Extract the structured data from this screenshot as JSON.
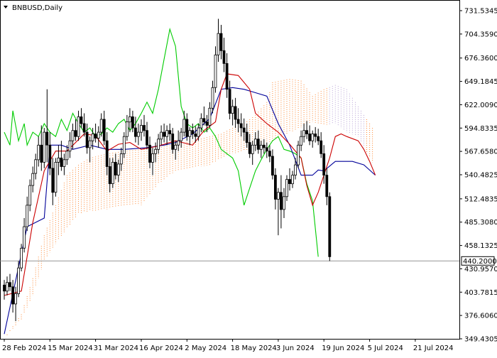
{
  "chart_data": {
    "type": "candlestick",
    "title": "BNBUSD,Daily",
    "current_price": 440.2,
    "current_price_label": "440.2000",
    "ylim": [
      349.43,
      731.5345
    ],
    "y_ticks": [
      {
        "label": "731.5345",
        "value": 731.5345
      },
      {
        "label": "704.3590",
        "value": 704.359
      },
      {
        "label": "676.3600",
        "value": 676.36
      },
      {
        "label": "649.1845",
        "value": 649.1845
      },
      {
        "label": "622.0090",
        "value": 622.009
      },
      {
        "label": "594.8335",
        "value": 594.8335
      },
      {
        "label": "567.6580",
        "value": 567.658
      },
      {
        "label": "540.4825",
        "value": 540.4825
      },
      {
        "label": "512.4835",
        "value": 512.4835
      },
      {
        "label": "485.3080",
        "value": 485.308
      },
      {
        "label": "458.1325",
        "value": 458.1325
      },
      {
        "label": "430.9570",
        "value": 430.957
      },
      {
        "label": "403.7815",
        "value": 403.7815
      },
      {
        "label": "376.6060",
        "value": 376.606
      },
      {
        "label": "349.4305",
        "value": 349.4305
      }
    ],
    "x_ticks": [
      {
        "label": "28 Feb 2024",
        "index": 0
      },
      {
        "label": "15 Mar 2024",
        "index": 16
      },
      {
        "label": "31 Mar 2024",
        "index": 32
      },
      {
        "label": "16 Apr 2024",
        "index": 48
      },
      {
        "label": "2 May 2024",
        "index": 64
      },
      {
        "label": "18 May 2024",
        "index": 80
      },
      {
        "label": "3 Jun 2024",
        "index": 96
      },
      {
        "label": "19 Jun 2024",
        "index": 112
      },
      {
        "label": "5 Jul 2024",
        "index": 128
      },
      {
        "label": "21 Jul 2024",
        "index": 144
      }
    ],
    "colors": {
      "tenkan": "#cc0000",
      "kijun": "#000099",
      "chikou": "#00cc00",
      "cloud": "#ff8833",
      "cloud_alt": "#b9a3d6",
      "candle": "#000000",
      "price_line": "#888888"
    },
    "candles": [
      [
        412,
        418,
        395,
        405
      ],
      [
        405,
        422,
        400,
        415
      ],
      [
        415,
        425,
        405,
        410
      ],
      [
        410,
        418,
        380,
        390
      ],
      [
        390,
        410,
        370,
        402
      ],
      [
        402,
        440,
        398,
        432
      ],
      [
        432,
        460,
        428,
        455
      ],
      [
        455,
        490,
        450,
        480
      ],
      [
        480,
        515,
        475,
        505
      ],
      [
        505,
        535,
        498,
        528
      ],
      [
        528,
        550,
        520,
        542
      ],
      [
        542,
        565,
        535,
        558
      ],
      [
        558,
        585,
        550,
        575
      ],
      [
        575,
        598,
        545,
        555
      ],
      [
        555,
        595,
        548,
        590
      ],
      [
        590,
        640,
        555,
        575
      ],
      [
        575,
        590,
        540,
        548
      ],
      [
        548,
        560,
        505,
        520
      ],
      [
        520,
        560,
        515,
        555
      ],
      [
        555,
        575,
        540,
        560
      ],
      [
        560,
        580,
        545,
        550
      ],
      [
        550,
        565,
        540,
        558
      ],
      [
        558,
        575,
        552,
        568
      ],
      [
        568,
        590,
        560,
        580
      ],
      [
        580,
        600,
        570,
        592
      ],
      [
        592,
        605,
        580,
        585
      ],
      [
        585,
        615,
        580,
        608
      ],
      [
        608,
        618,
        595,
        600
      ],
      [
        600,
        612,
        585,
        590
      ],
      [
        590,
        600,
        565,
        572
      ],
      [
        572,
        585,
        555,
        580
      ],
      [
        580,
        595,
        570,
        588
      ],
      [
        588,
        600,
        578,
        583
      ],
      [
        583,
        597,
        572,
        590
      ],
      [
        590,
        612,
        585,
        605
      ],
      [
        605,
        615,
        575,
        580
      ],
      [
        580,
        590,
        540,
        550
      ],
      [
        550,
        560,
        520,
        530
      ],
      [
        530,
        560,
        525,
        555
      ],
      [
        555,
        565,
        535,
        540
      ],
      [
        540,
        558,
        532,
        553
      ],
      [
        553,
        572,
        545,
        565
      ],
      [
        565,
        590,
        560,
        585
      ],
      [
        585,
        610,
        580,
        602
      ],
      [
        602,
        618,
        590,
        608
      ],
      [
        608,
        615,
        590,
        595
      ],
      [
        595,
        608,
        578,
        585
      ],
      [
        585,
        600,
        575,
        590
      ],
      [
        590,
        605,
        580,
        598
      ],
      [
        598,
        610,
        585,
        592
      ],
      [
        592,
        602,
        570,
        575
      ],
      [
        575,
        585,
        548,
        555
      ],
      [
        555,
        572,
        540,
        565
      ],
      [
        565,
        578,
        555,
        570
      ],
      [
        570,
        588,
        565,
        582
      ],
      [
        582,
        598,
        575,
        590
      ],
      [
        590,
        600,
        578,
        585
      ],
      [
        585,
        598,
        575,
        592
      ],
      [
        592,
        600,
        580,
        588
      ],
      [
        588,
        595,
        565,
        570
      ],
      [
        570,
        580,
        558,
        575
      ],
      [
        575,
        592,
        568,
        580
      ],
      [
        580,
        595,
        572,
        590
      ],
      [
        590,
        615,
        585,
        605
      ],
      [
        605,
        612,
        580,
        585
      ],
      [
        585,
        596,
        575,
        592
      ],
      [
        592,
        600,
        582,
        588
      ],
      [
        588,
        597,
        578,
        585
      ],
      [
        585,
        600,
        580,
        595
      ],
      [
        595,
        612,
        590,
        606
      ],
      [
        606,
        620,
        598,
        602
      ],
      [
        602,
        610,
        590,
        598
      ],
      [
        598,
        625,
        595,
        618
      ],
      [
        618,
        650,
        612,
        642
      ],
      [
        642,
        690,
        636,
        680
      ],
      [
        680,
        722,
        672,
        705
      ],
      [
        705,
        715,
        675,
        685
      ],
      [
        685,
        700,
        660,
        670
      ],
      [
        670,
        682,
        630,
        640
      ],
      [
        640,
        650,
        605,
        612
      ],
      [
        612,
        628,
        598,
        620
      ],
      [
        620,
        630,
        595,
        605
      ],
      [
        605,
        618,
        590,
        600
      ],
      [
        600,
        612,
        585,
        595
      ],
      [
        595,
        606,
        580,
        590
      ],
      [
        590,
        600,
        572,
        578
      ],
      [
        578,
        588,
        560,
        565
      ],
      [
        565,
        580,
        552,
        575
      ],
      [
        575,
        590,
        568,
        582
      ],
      [
        582,
        592,
        565,
        570
      ],
      [
        570,
        580,
        560,
        575
      ],
      [
        575,
        582,
        565,
        572
      ],
      [
        572,
        578,
        560,
        568
      ],
      [
        568,
        575,
        555,
        562
      ],
      [
        562,
        570,
        535,
        540
      ],
      [
        540,
        548,
        500,
        512
      ],
      [
        512,
        525,
        470,
        520
      ],
      [
        520,
        540,
        478,
        500
      ],
      [
        500,
        525,
        490,
        515
      ],
      [
        515,
        540,
        510,
        535
      ],
      [
        535,
        548,
        522,
        530
      ],
      [
        530,
        545,
        525,
        540
      ],
      [
        540,
        560,
        535,
        552
      ],
      [
        552,
        580,
        548,
        575
      ],
      [
        575,
        592,
        568,
        585
      ],
      [
        585,
        600,
        578,
        592
      ],
      [
        592,
        603,
        582,
        588
      ],
      [
        588,
        598,
        575,
        580
      ],
      [
        580,
        592,
        572,
        588
      ],
      [
        588,
        596,
        578,
        585
      ],
      [
        585,
        594,
        575,
        580
      ],
      [
        580,
        590,
        560,
        565
      ],
      [
        565,
        575,
        530,
        540
      ],
      [
        540,
        548,
        505,
        515
      ],
      [
        515,
        520,
        440,
        445
      ]
    ],
    "tenkan": [
      [
        0,
        400
      ],
      [
        6,
        405
      ],
      [
        10,
        485
      ],
      [
        14,
        545
      ],
      [
        18,
        568
      ],
      [
        22,
        568
      ],
      [
        28,
        588
      ],
      [
        32,
        586
      ],
      [
        36,
        568
      ],
      [
        40,
        576
      ],
      [
        44,
        578
      ],
      [
        48,
        570
      ],
      [
        54,
        574
      ],
      [
        60,
        580
      ],
      [
        66,
        575
      ],
      [
        70,
        592
      ],
      [
        74,
        602
      ],
      [
        76,
        640
      ],
      [
        78,
        658
      ],
      [
        82,
        656
      ],
      [
        84,
        648
      ],
      [
        86,
        640
      ],
      [
        88,
        612
      ],
      [
        92,
        600
      ],
      [
        96,
        590
      ],
      [
        100,
        576
      ],
      [
        104,
        560
      ],
      [
        106,
        528
      ],
      [
        108,
        505
      ],
      [
        110,
        520
      ],
      [
        112,
        540
      ],
      [
        114,
        560
      ],
      [
        116,
        585
      ],
      [
        118,
        588
      ],
      [
        120,
        585
      ],
      [
        124,
        580
      ],
      [
        126,
        570
      ],
      [
        128,
        556
      ],
      [
        130,
        540
      ]
    ],
    "kijun": [
      [
        0,
        355
      ],
      [
        8,
        480
      ],
      [
        14,
        490
      ],
      [
        16,
        575
      ],
      [
        20,
        575
      ],
      [
        24,
        570
      ],
      [
        30,
        575
      ],
      [
        36,
        570
      ],
      [
        42,
        570
      ],
      [
        50,
        572
      ],
      [
        56,
        575
      ],
      [
        60,
        578
      ],
      [
        66,
        588
      ],
      [
        72,
        606
      ],
      [
        76,
        640
      ],
      [
        80,
        642
      ],
      [
        84,
        640
      ],
      [
        88,
        636
      ],
      [
        92,
        632
      ],
      [
        96,
        600
      ],
      [
        100,
        575
      ],
      [
        104,
        540
      ],
      [
        108,
        540
      ],
      [
        110,
        546
      ],
      [
        112,
        545
      ],
      [
        116,
        556
      ],
      [
        122,
        556
      ],
      [
        126,
        552
      ],
      [
        130,
        540
      ]
    ],
    "chikou": [
      [
        0,
        590
      ],
      [
        2,
        575
      ],
      [
        3,
        615
      ],
      [
        5,
        580
      ],
      [
        7,
        600
      ],
      [
        8,
        575
      ],
      [
        10,
        590
      ],
      [
        12,
        585
      ],
      [
        14,
        600
      ],
      [
        16,
        590
      ],
      [
        18,
        585
      ],
      [
        20,
        605
      ],
      [
        22,
        592
      ],
      [
        24,
        612
      ],
      [
        26,
        600
      ],
      [
        28,
        590
      ],
      [
        30,
        595
      ],
      [
        32,
        585
      ],
      [
        34,
        588
      ],
      [
        36,
        595
      ],
      [
        38,
        590
      ],
      [
        40,
        600
      ],
      [
        42,
        605
      ],
      [
        44,
        592
      ],
      [
        46,
        600
      ],
      [
        48,
        612
      ],
      [
        50,
        625
      ],
      [
        52,
        612
      ],
      [
        54,
        640
      ],
      [
        56,
        675
      ],
      [
        58,
        710
      ],
      [
        60,
        690
      ],
      [
        62,
        620
      ],
      [
        64,
        600
      ],
      [
        66,
        595
      ],
      [
        68,
        600
      ],
      [
        70,
        590
      ],
      [
        72,
        595
      ],
      [
        74,
        585
      ],
      [
        76,
        570
      ],
      [
        78,
        565
      ],
      [
        80,
        560
      ],
      [
        82,
        545
      ],
      [
        84,
        505
      ],
      [
        86,
        525
      ],
      [
        88,
        545
      ],
      [
        90,
        558
      ],
      [
        92,
        570
      ],
      [
        94,
        580
      ],
      [
        96,
        585
      ],
      [
        98,
        570
      ],
      [
        100,
        568
      ],
      [
        102,
        565
      ],
      [
        104,
        560
      ],
      [
        106,
        530
      ],
      [
        108,
        510
      ],
      [
        110,
        445
      ]
    ],
    "cloud": [
      [
        0,
        350,
        350
      ],
      [
        6,
        378,
        372
      ],
      [
        10,
        420,
        400
      ],
      [
        14,
        470,
        440
      ],
      [
        18,
        505,
        460
      ],
      [
        22,
        540,
        478
      ],
      [
        26,
        552,
        495
      ],
      [
        30,
        560,
        498
      ],
      [
        36,
        565,
        500
      ],
      [
        42,
        568,
        505
      ],
      [
        48,
        570,
        505
      ],
      [
        54,
        572,
        530
      ],
      [
        60,
        576,
        545
      ],
      [
        66,
        580,
        548
      ],
      [
        72,
        585,
        552
      ],
      [
        76,
        588,
        560
      ],
      [
        80,
        595,
        565
      ],
      [
        84,
        600,
        568
      ],
      [
        88,
        610,
        570
      ],
      [
        92,
        625,
        575
      ],
      [
        94,
        648,
        580
      ],
      [
        100,
        652,
        590
      ],
      [
        104,
        650,
        595
      ],
      [
        108,
        632,
        602
      ],
      [
        112,
        640,
        598
      ],
      [
        116,
        645,
        600
      ],
      [
        120,
        640,
        590
      ],
      [
        124,
        620,
        585
      ],
      [
        128,
        600,
        560
      ],
      [
        130,
        590,
        550
      ]
    ]
  }
}
